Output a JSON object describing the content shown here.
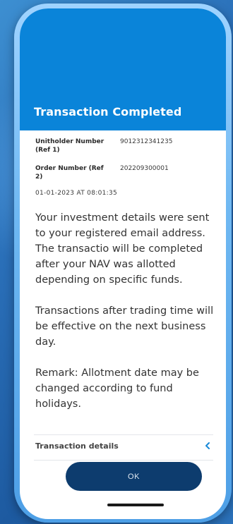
{
  "header": {
    "title": "Transaction Completed"
  },
  "info": {
    "unitholder_label": "Unitholder Number (Ref 1)",
    "unitholder_value": "9012312341235",
    "order_label": "Order Number (Ref 2)",
    "order_value": "202209300001",
    "date": "01-01-2023 AT 08:01:35"
  },
  "message": {
    "paragraph_1": "Your investment details were sent to your registered email address. The transactio will be completed after your NAV was allotted depending on specific funds.",
    "paragraph_2": "Transactions after trading time will be effective on the next business day.",
    "paragraph_3": "Remark: Allotment date may be changed according to fund holidays."
  },
  "details": {
    "label": "Transaction details",
    "chevron_icon": "chevron-left-icon"
  },
  "footer": {
    "ok_label": "OK"
  },
  "colors": {
    "header_bg": "#0a84d9",
    "button_bg": "#0d3c6e",
    "chevron": "#1a8ad8"
  }
}
